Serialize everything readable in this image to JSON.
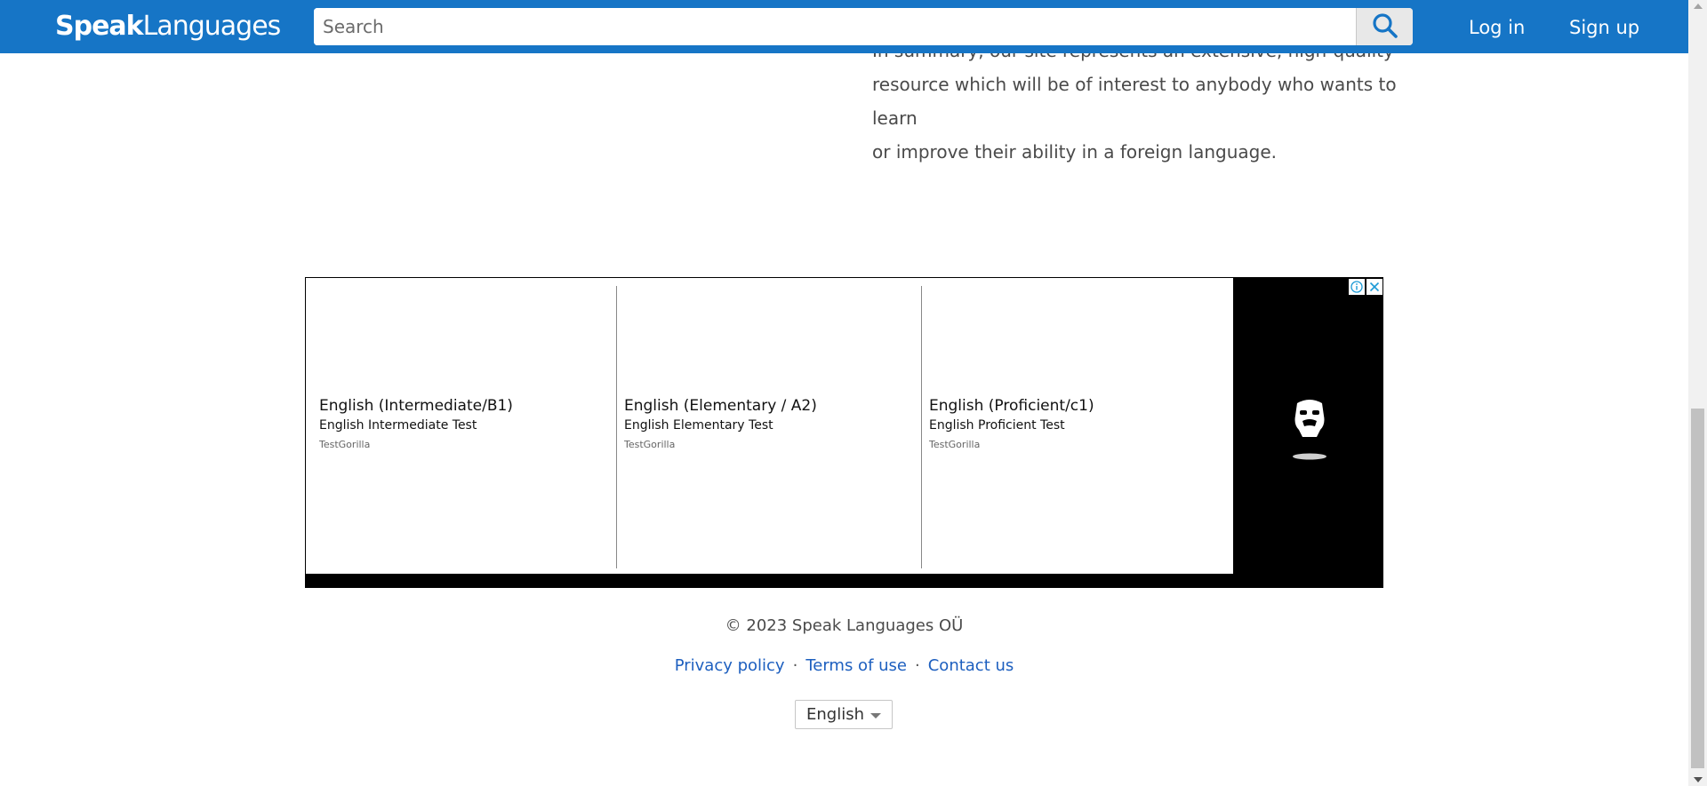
{
  "header": {
    "logo_bold": "Speak",
    "logo_light": "Languages",
    "search_placeholder": "Search",
    "login_label": "Log in",
    "signup_label": "Sign up",
    "bar_color": "#1675c6"
  },
  "content": {
    "summary_lines": [
      "In summary, our site represents an extensive, high-quality",
      "resource which will be of interest to anybody who wants to learn",
      "or improve their ability in a foreign language."
    ]
  },
  "ad": {
    "items": [
      {
        "title": "English (Intermediate/B1)",
        "subtitle": "English Intermediate Test",
        "source": "TestGorilla"
      },
      {
        "title": "English (Elementary / A2)",
        "subtitle": "English Elementary Test",
        "source": "TestGorilla"
      },
      {
        "title": "English (Proficient/c1)",
        "subtitle": "English Proficient Test",
        "source": "TestGorilla"
      }
    ],
    "info_icon": "info-icon",
    "close_icon": "close-icon",
    "brand_icon": "gorilla-icon"
  },
  "footer": {
    "copyright": "© 2023 Speak Languages OÜ",
    "links": [
      "Privacy policy",
      "Terms of use",
      "Contact us"
    ],
    "separator": "·",
    "language_selected": "English",
    "link_color": "#1d5fbf"
  }
}
